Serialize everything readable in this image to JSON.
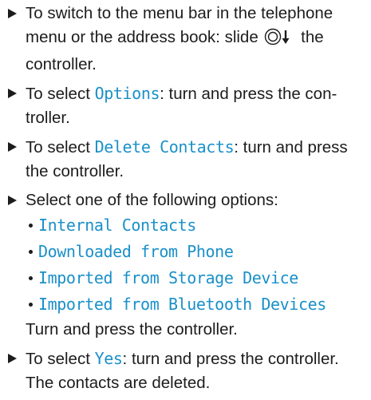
{
  "steps": [
    {
      "before": "To switch to the menu bar in the telephone menu or the address book: slide ",
      "icon": "controller-slide-down-icon",
      "after": " the controller."
    },
    {
      "before": "To select ",
      "term": "Options",
      "after": ": turn and press the con-troller."
    },
    {
      "before": "To select ",
      "term": "Delete Contacts",
      "after": ": turn and press the controller."
    },
    {
      "text": "Select one of the following options:",
      "options": [
        "Internal Contacts",
        "Downloaded from Phone",
        "Imported from Storage Device",
        "Imported from Bluetooth Devices"
      ],
      "followup": "Turn and press the controller."
    },
    {
      "before": "To select ",
      "term": "Yes",
      "after": ": turn and press the controller.",
      "result": "The contacts are deleted."
    }
  ],
  "colors": {
    "text": "#1c1c1c",
    "term": "#1a90c9"
  }
}
